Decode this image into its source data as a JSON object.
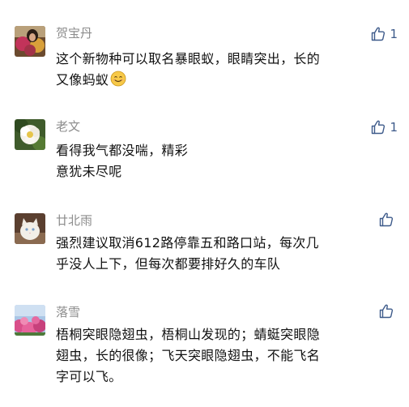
{
  "comments": [
    {
      "name": "贺宝丹",
      "likes": "1",
      "lines": [
        "这个新物种可以取名暴眼蚁，眼睛突出，长的",
        "又像蚂蚁"
      ],
      "emoji": "smile-emoji"
    },
    {
      "name": "老文",
      "likes": "1",
      "lines": [
        "看得我气都没喘，精彩",
        "意犹未尽呢"
      ]
    },
    {
      "name": "廿北雨",
      "likes": "",
      "lines": [
        "强烈建议取消612路停靠五和路口站，每次几",
        "乎没人上下，但每次都要排好久的车队"
      ]
    },
    {
      "name": "落雪",
      "likes": "",
      "lines": [
        "梧桐突眼隐翅虫，梧桐山发现的；蜻蜓突眼隐",
        "翅虫，长的很像；飞天突眼隐翅虫，不能飞名",
        "字可以飞。"
      ]
    }
  ],
  "icons": {
    "like": "thumbs-up-icon"
  },
  "colors": {
    "name": "#8c8c8c",
    "like_blue": "#3d5a8a",
    "text": "#111111"
  }
}
